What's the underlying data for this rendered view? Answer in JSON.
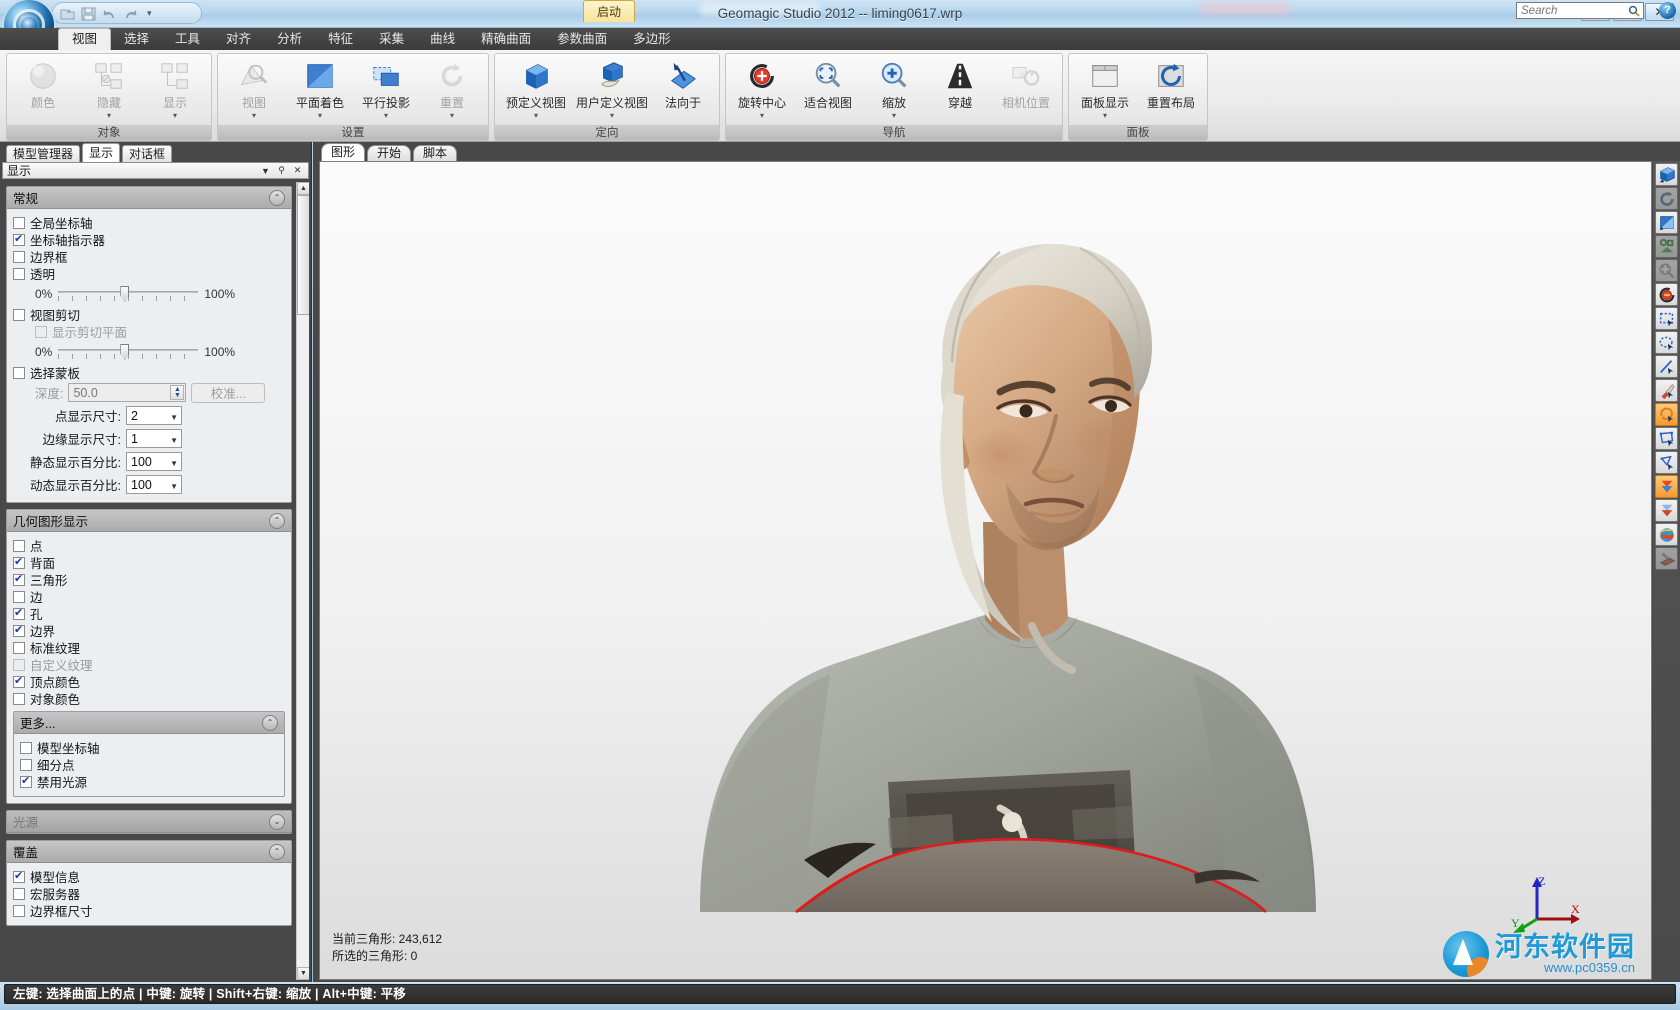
{
  "window": {
    "title": "Geomagic Studio 2012 -- liming0617.wrp",
    "auto_tab": "启动",
    "minimize": "—",
    "maximize": "❐",
    "close": "✕"
  },
  "quick_access": {
    "icons": [
      "open-icon",
      "save-icon",
      "undo-icon",
      "redo-icon"
    ],
    "caret": "▾"
  },
  "ribbon": {
    "tabs": [
      {
        "label": "视图",
        "active": true
      },
      {
        "label": "选择",
        "active": false
      },
      {
        "label": "工具",
        "active": false
      },
      {
        "label": "对齐",
        "active": false
      },
      {
        "label": "分析",
        "active": false
      },
      {
        "label": "特征",
        "active": false
      },
      {
        "label": "采集",
        "active": false
      },
      {
        "label": "曲线",
        "active": false
      },
      {
        "label": "精确曲面",
        "active": false
      },
      {
        "label": "参数曲面",
        "active": false
      },
      {
        "label": "多边形",
        "active": false
      }
    ],
    "search": {
      "placeholder": "Search",
      "icon": "search-icon"
    },
    "help": "?",
    "groups": [
      {
        "title": "对象",
        "items": [
          {
            "label": "颜色",
            "icon": "sphere-icon",
            "dropdown": false,
            "disabled": true
          },
          {
            "label": "隐藏",
            "icon": "hide-objects-icon",
            "dropdown": true,
            "disabled": true
          },
          {
            "label": "显示",
            "icon": "show-objects-icon",
            "dropdown": true,
            "disabled": true
          }
        ]
      },
      {
        "title": "设置",
        "items": [
          {
            "label": "视图",
            "icon": "view-settings-icon",
            "dropdown": true,
            "disabled": true
          },
          {
            "label": "平面着色",
            "icon": "flat-shading-icon",
            "dropdown": true,
            "disabled": false
          },
          {
            "label": "平行投影",
            "icon": "parallel-projection-icon",
            "dropdown": true,
            "disabled": false
          },
          {
            "label": "重置",
            "icon": "reset-icon",
            "dropdown": true,
            "disabled": true
          }
        ]
      },
      {
        "title": "定向",
        "items": [
          {
            "label": "预定义视图",
            "icon": "predefined-view-icon",
            "dropdown": true,
            "disabled": false
          },
          {
            "label": "用户定义视图",
            "icon": "user-defined-view-icon",
            "dropdown": true,
            "disabled": false
          },
          {
            "label": "法向于",
            "icon": "normal-to-icon",
            "dropdown": false,
            "disabled": false
          }
        ]
      },
      {
        "title": "导航",
        "items": [
          {
            "label": "旋转中心",
            "icon": "rotation-center-icon",
            "dropdown": true,
            "disabled": false
          },
          {
            "label": "适合视图",
            "icon": "fit-view-icon",
            "dropdown": false,
            "disabled": false
          },
          {
            "label": "缩放",
            "icon": "zoom-icon",
            "dropdown": true,
            "disabled": false
          },
          {
            "label": "穿越",
            "icon": "fly-through-icon",
            "dropdown": false,
            "disabled": false
          },
          {
            "label": "相机位置",
            "icon": "camera-position-icon",
            "dropdown": false,
            "disabled": true
          }
        ]
      },
      {
        "title": "面板",
        "items": [
          {
            "label": "面板显示",
            "icon": "panel-display-icon",
            "dropdown": true,
            "disabled": false
          },
          {
            "label": "重置布局",
            "icon": "reset-layout-icon",
            "dropdown": false,
            "disabled": false
          }
        ]
      }
    ]
  },
  "left_panel": {
    "tabs": [
      {
        "label": "模型管理器",
        "active": false
      },
      {
        "label": "显示",
        "active": true
      },
      {
        "label": "对话框",
        "active": false
      }
    ],
    "header": {
      "title": "显示",
      "menu_icon": "▼",
      "pin_icon": "⚲",
      "close_icon": "✕"
    },
    "sections": [
      {
        "name": "常规",
        "collapsed": false,
        "chevron": "⌃",
        "checkboxes": [
          {
            "label": "全局坐标轴",
            "checked": false,
            "disabled": false
          },
          {
            "label": "坐标轴指示器",
            "checked": true,
            "disabled": false
          },
          {
            "label": "边界框",
            "checked": false,
            "disabled": false
          },
          {
            "label": "透明",
            "checked": false,
            "disabled": false
          }
        ],
        "slider1": {
          "min_label": "0%",
          "max_label": "100%",
          "value": 45
        },
        "view_clip": {
          "label": "视图剪切",
          "checked": false
        },
        "show_clip_plane": {
          "label": "显示剪切平面",
          "checked": false,
          "disabled": true
        },
        "slider2": {
          "min_label": "0%",
          "max_label": "100%",
          "value": 45
        },
        "select_mask": {
          "label": "选择蒙板",
          "checked": false
        },
        "depth": {
          "label": "深度:",
          "value": "50.0"
        },
        "calibrate_button": "校准...",
        "selects": [
          {
            "label": "点显示尺寸:",
            "value": "2"
          },
          {
            "label": "边缘显示尺寸:",
            "value": "1"
          },
          {
            "label": "静态显示百分比:",
            "value": "100"
          },
          {
            "label": "动态显示百分比:",
            "value": "100"
          }
        ]
      },
      {
        "name": "几何图形显示",
        "collapsed": false,
        "chevron": "⌃",
        "checkboxes": [
          {
            "label": "点",
            "checked": false,
            "disabled": false
          },
          {
            "label": "背面",
            "checked": true,
            "disabled": false
          },
          {
            "label": "三角形",
            "checked": true,
            "disabled": false
          },
          {
            "label": "边",
            "checked": false,
            "disabled": false
          },
          {
            "label": "孔",
            "checked": true,
            "disabled": false
          },
          {
            "label": "边界",
            "checked": true,
            "disabled": false
          },
          {
            "label": "标准纹理",
            "checked": false,
            "disabled": false
          },
          {
            "label": "自定义纹理",
            "checked": false,
            "disabled": true
          },
          {
            "label": "顶点颜色",
            "checked": true,
            "disabled": false
          },
          {
            "label": "对象颜色",
            "checked": false,
            "disabled": false
          }
        ],
        "sub": {
          "name": "更多...",
          "chevron": "⌃",
          "checkboxes": [
            {
              "label": "模型坐标轴",
              "checked": false,
              "disabled": false
            },
            {
              "label": "细分点",
              "checked": false,
              "disabled": false
            },
            {
              "label": "禁用光源",
              "checked": true,
              "disabled": false
            }
          ]
        }
      },
      {
        "name": "光源",
        "collapsed": true,
        "chevron": "⌄",
        "checkboxes": []
      },
      {
        "name": "覆盖",
        "collapsed": false,
        "chevron": "⌃",
        "checkboxes": [
          {
            "label": "模型信息",
            "checked": true,
            "disabled": false
          },
          {
            "label": "宏服务器",
            "checked": false,
            "disabled": false
          },
          {
            "label": "边界框尺寸",
            "checked": false,
            "disabled": false
          }
        ]
      }
    ]
  },
  "viewport": {
    "tabs": [
      {
        "label": "图形",
        "active": true
      },
      {
        "label": "开始",
        "active": false
      },
      {
        "label": "脚本",
        "active": false
      }
    ],
    "model_info": {
      "current_triangles": "当前三角形: 243,612",
      "selected_triangles": "所选的三角形: 0"
    },
    "axis": {
      "x": "X",
      "y": "Y",
      "z": "Z",
      "x_color": "#d40000",
      "y_color": "#00a000",
      "z_color": "#1414d0"
    },
    "watermark": {
      "text": "河东软件园",
      "url": "www.pc0359.cn"
    }
  },
  "right_toolbar": {
    "tools": [
      {
        "icon": "box-select-icon",
        "selected": false,
        "disabled": false
      },
      {
        "icon": "reset-rotate-icon",
        "selected": false,
        "disabled": true
      },
      {
        "icon": "plane-shade-icon",
        "selected": false,
        "disabled": false
      },
      {
        "icon": "primitive-icon",
        "selected": false,
        "disabled": true
      },
      {
        "icon": "fit-magnifier-icon",
        "selected": false,
        "disabled": true
      },
      {
        "icon": "rotation-center-icon",
        "selected": false,
        "disabled": false
      },
      {
        "icon": "rectangle-select-icon",
        "selected": false,
        "disabled": false
      },
      {
        "icon": "ellipse-select-icon",
        "selected": false,
        "disabled": false
      },
      {
        "icon": "line-select-icon",
        "selected": false,
        "disabled": false
      },
      {
        "icon": "paint-select-icon",
        "selected": false,
        "disabled": false
      },
      {
        "icon": "lasso-select-icon",
        "selected": true,
        "disabled": false
      },
      {
        "icon": "polygon-select-icon",
        "selected": false,
        "disabled": false
      },
      {
        "icon": "freeform-select-icon",
        "selected": false,
        "disabled": false
      },
      {
        "icon": "select-through-icon",
        "selected": true,
        "disabled": false
      },
      {
        "icon": "select-visible-icon",
        "selected": false,
        "disabled": false
      },
      {
        "icon": "globe-select-icon",
        "selected": false,
        "disabled": false
      },
      {
        "icon": "plane-cut-icon",
        "selected": false,
        "disabled": true
      }
    ]
  },
  "status_bar": {
    "text": "左键: 选择曲面上的点 | 中键: 旋转 | Shift+右键: 缩放 | Alt+中键: 平移"
  }
}
